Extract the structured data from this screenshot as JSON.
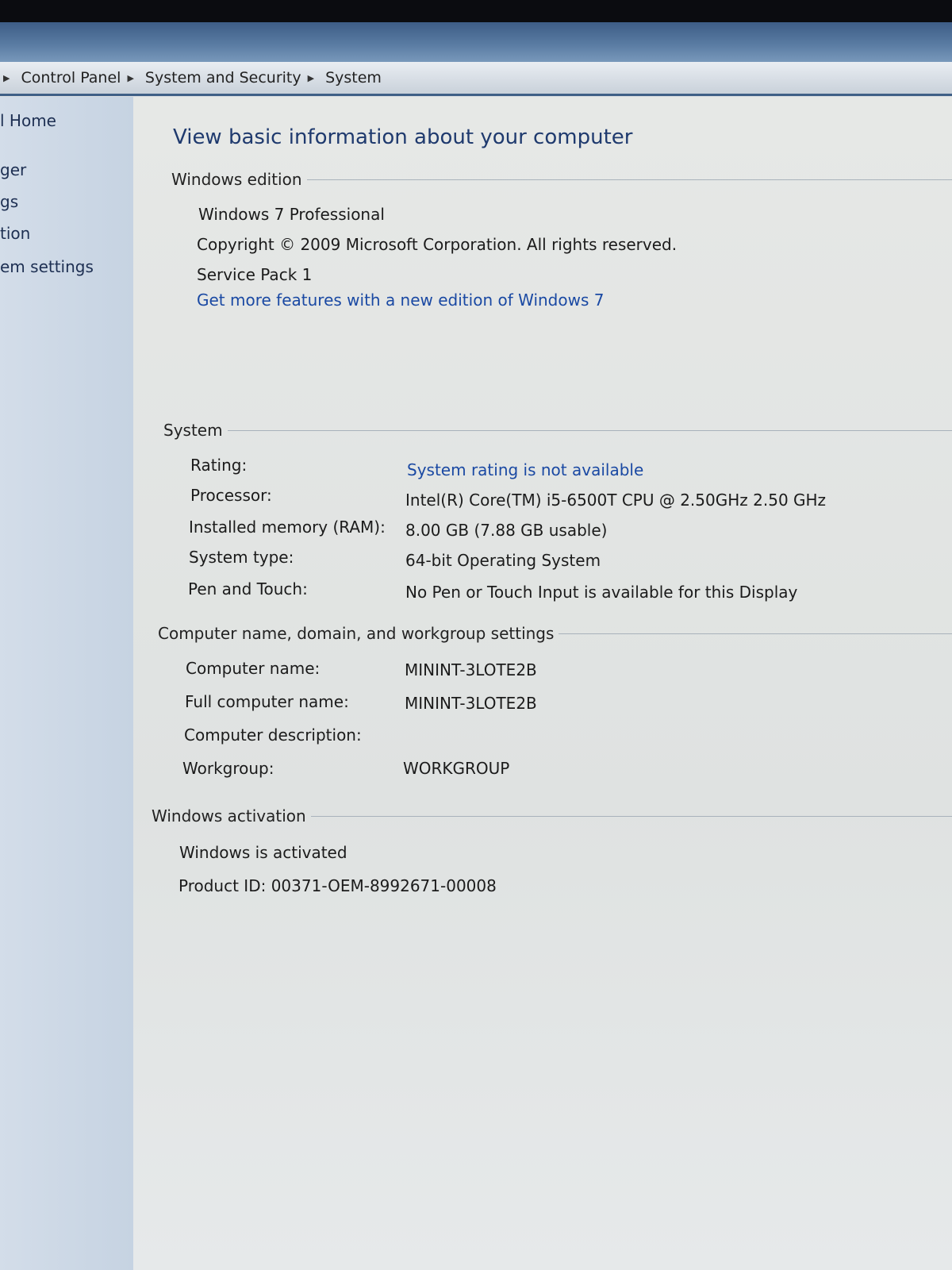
{
  "breadcrumb": [
    "Control Panel",
    "System and Security",
    "System"
  ],
  "sidebar": {
    "items": [
      "l Home",
      "ger",
      "gs",
      "tion",
      "em settings"
    ]
  },
  "page_title": "View basic information about your computer",
  "windows_edition": {
    "heading": "Windows edition",
    "edition": "Windows 7 Professional",
    "copyright": "Copyright © 2009 Microsoft Corporation.  All rights reserved.",
    "service_pack": "Service Pack 1",
    "upgrade_link": "Get more features with a new edition of Windows 7"
  },
  "system": {
    "heading": "System",
    "rows": [
      {
        "label": "Rating:",
        "value": "System rating is not available"
      },
      {
        "label": "Processor:",
        "value": "Intel(R) Core(TM) i5-6500T CPU @ 2.50GHz   2.50 GHz"
      },
      {
        "label": "Installed memory (RAM):",
        "value": "8.00 GB (7.88 GB usable)"
      },
      {
        "label": "System type:",
        "value": "64-bit Operating System"
      },
      {
        "label": "Pen and Touch:",
        "value": "No Pen or Touch Input is available for this Display"
      }
    ]
  },
  "computer_name": {
    "heading": "Computer name, domain, and workgroup settings",
    "rows": [
      {
        "label": "Computer name:",
        "value": "MININT-3LOTE2B"
      },
      {
        "label": "Full computer name:",
        "value": "MININT-3LOTE2B"
      },
      {
        "label": "Computer description:",
        "value": ""
      },
      {
        "label": "Workgroup:",
        "value": "WORKGROUP"
      }
    ]
  },
  "activation": {
    "heading": "Windows activation",
    "status": "Windows is activated",
    "product_id": "Product ID: 00371-OEM-8992671-00008"
  }
}
